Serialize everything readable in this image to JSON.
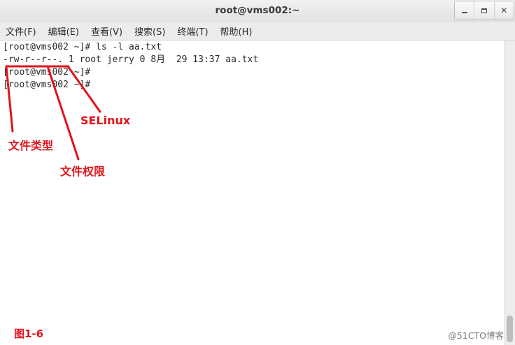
{
  "window": {
    "title": "root@vms002:~",
    "controls": [
      "minimize",
      "maximize",
      "close"
    ]
  },
  "menu": [
    {
      "label": "文件(F)"
    },
    {
      "label": "编辑(E)"
    },
    {
      "label": "查看(V)"
    },
    {
      "label": "搜索(S)"
    },
    {
      "label": "终端(T)"
    },
    {
      "label": "帮助(H)"
    }
  ],
  "terminal": {
    "lines": [
      "[root@vms002 ~]# ls -l aa.txt",
      "-rw-r--r--. 1 root jerry 0 8月  29 13:37 aa.txt",
      "[root@vms002 ~]#",
      "[root@vms002 ~]#"
    ]
  },
  "annotations": {
    "selinux": "SELinux",
    "file_type": "文件类型",
    "file_permission": "文件权限",
    "figure_label": "图1-6",
    "color": "#e0151b"
  },
  "watermark": "@51CTO博客"
}
